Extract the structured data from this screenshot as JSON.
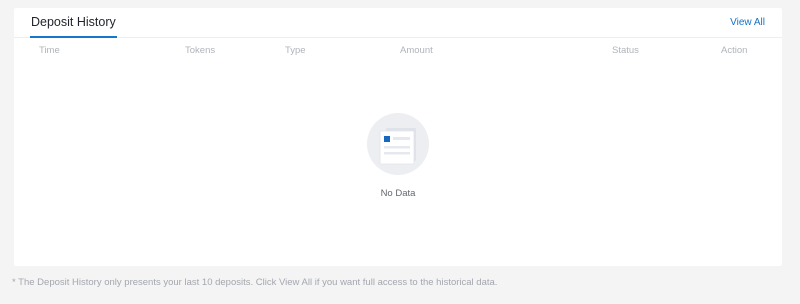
{
  "card": {
    "tab_label": "Deposit History",
    "view_all_label": "View All"
  },
  "table": {
    "columns": [
      "Time",
      "Tokens",
      "Type",
      "Amount",
      "Status",
      "Action"
    ]
  },
  "empty_state": {
    "icon": "empty-document-icon",
    "text": "No Data"
  },
  "footnote": "* The Deposit History only presents your last 10 deposits. Click View All if you want full access to the historical data.",
  "colors": {
    "accent": "#1677c8",
    "background": "#f4f4f5",
    "card": "#ffffff"
  }
}
